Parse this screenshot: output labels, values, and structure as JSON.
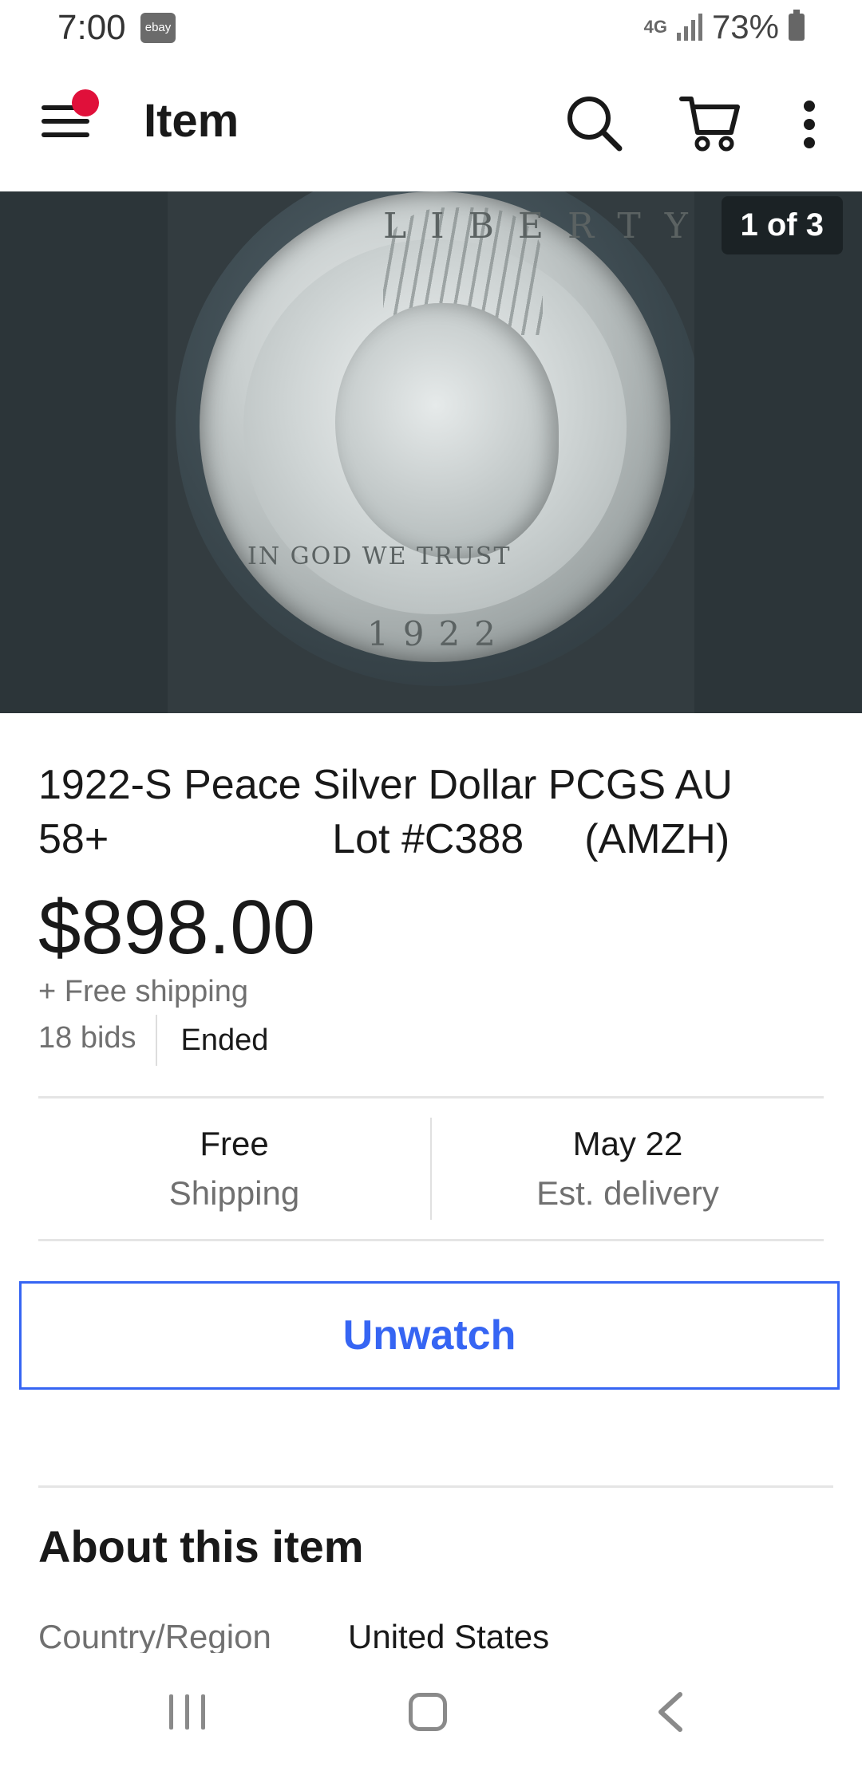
{
  "status_bar": {
    "time": "7:00",
    "app_badge": "ebay",
    "network": "4G",
    "battery": "73%"
  },
  "app_bar": {
    "title": "Item",
    "icons": [
      "menu-icon",
      "search-icon",
      "cart-icon",
      "more-icon"
    ],
    "notification_color": "#e0103a"
  },
  "gallery": {
    "counter": "1 of 3",
    "coin_inscriptions": {
      "top": "LIBERTY",
      "motto": "IN GOD WE TRUST",
      "year": "1922"
    }
  },
  "listing": {
    "title_part1": "1922-S Peace Silver Dollar PCGS AU 58+",
    "title_part2": "Lot #C388",
    "title_part3": "(AMZH)",
    "price": "$898.00",
    "shipping_note": "+ Free shipping",
    "bids": "18 bids",
    "status": "Ended"
  },
  "info": {
    "shipping_main": "Free",
    "shipping_sub": "Shipping",
    "delivery_main": "May 22",
    "delivery_sub": "Est. delivery"
  },
  "actions": {
    "unwatch_label": "Unwatch",
    "accent_color": "#3665f3"
  },
  "about": {
    "title": "About this item",
    "specs": [
      {
        "label": "Country/Region",
        "value": "United States"
      }
    ]
  },
  "nav": {
    "icons": [
      "recents-icon",
      "home-icon",
      "back-icon"
    ]
  }
}
